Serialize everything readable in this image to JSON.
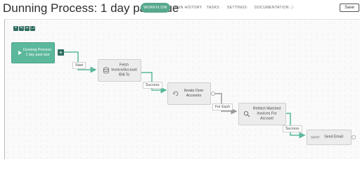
{
  "header": {
    "title": "Dunning Process: 1 day past due",
    "tabs": [
      {
        "label": "WORKFLOW",
        "active": true
      },
      {
        "label": "RUN HISTORY",
        "active": false
      },
      {
        "label": "TASKS",
        "active": false
      },
      {
        "label": "SETTINGS",
        "active": false
      },
      {
        "label": "DOCUMENTATION ⓘ",
        "active": false
      }
    ],
    "save_label": "Save"
  },
  "toolbar": {
    "icons": [
      "add-icon",
      "edit-icon",
      "link-icon",
      "copy-icon"
    ]
  },
  "workflow": {
    "nodes": [
      {
        "label": "Dunning Process: 1 day past due"
      },
      {
        "label": "Fetch Invoice/Account /Bill-To"
      },
      {
        "label": "Iterate Over Accounts"
      },
      {
        "label": "Refetch Matched Invoices For Account"
      },
      {
        "label": "Send Email",
        "icon_text": "SMTP"
      }
    ],
    "edge_labels": [
      "Start",
      "Success",
      "For Each",
      "Success"
    ]
  },
  "colors": {
    "accent": "#58a88d",
    "start_node": "#5bb89c",
    "success_edge": "#5bb89c",
    "foreach_edge": "#9a9a9a"
  }
}
